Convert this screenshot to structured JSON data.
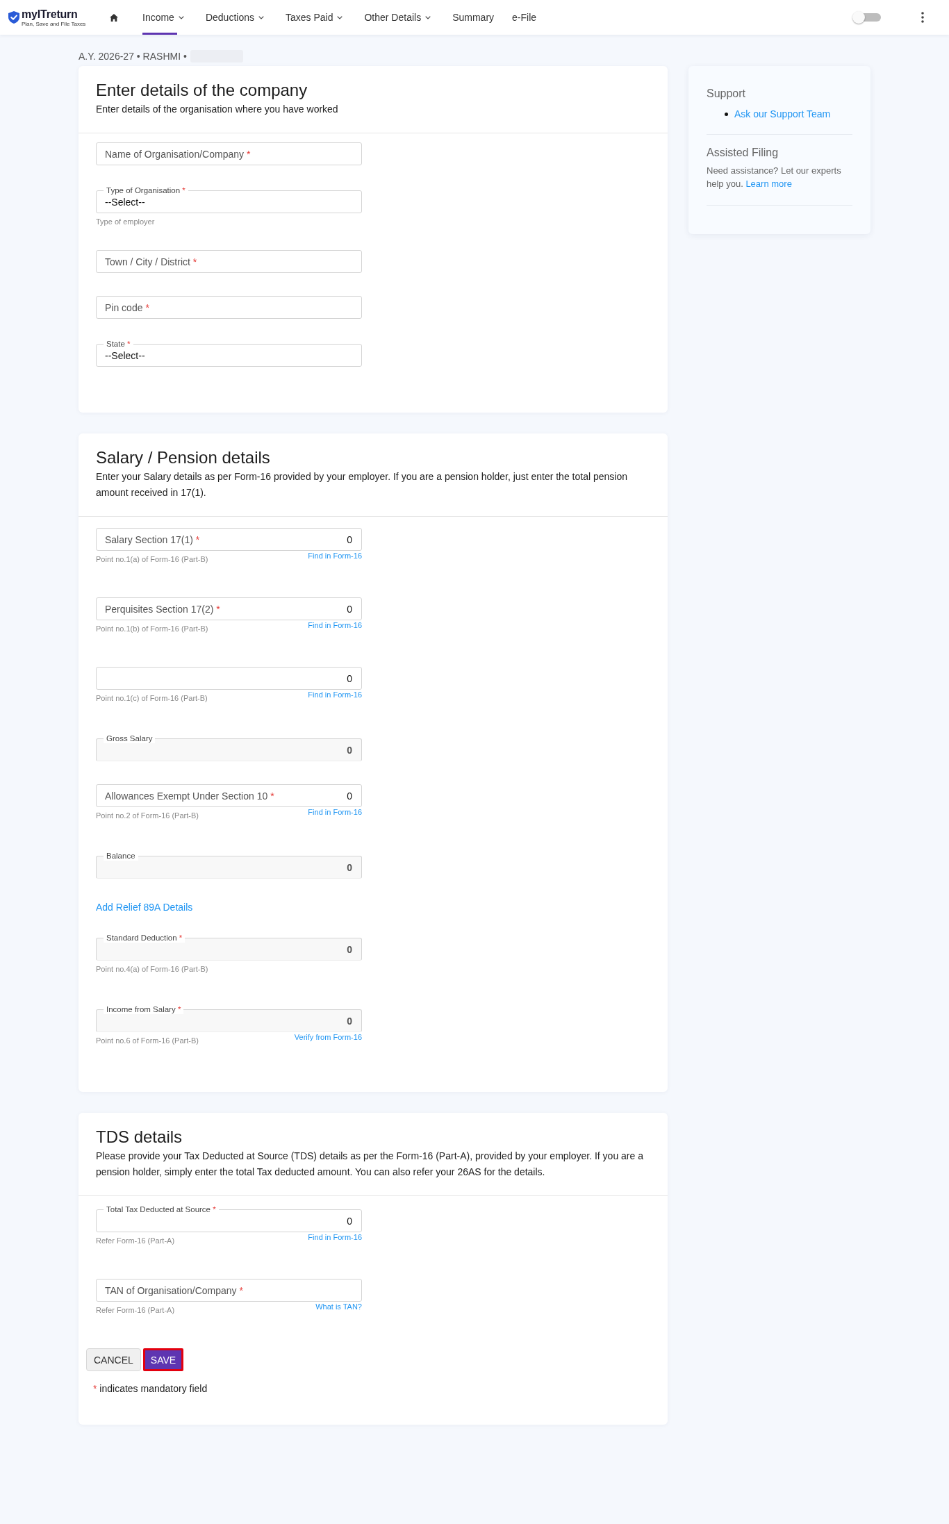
{
  "header": {
    "logo": {
      "wordmark": "myITreturn",
      "tagline": "Plan, Save and File Taxes"
    },
    "nav": [
      {
        "label": "Income",
        "menu": true,
        "selected": true
      },
      {
        "label": "Deductions",
        "menu": true,
        "selected": false
      },
      {
        "label": "Taxes Paid",
        "menu": true,
        "selected": false
      },
      {
        "label": "Other Details",
        "menu": true,
        "selected": false
      },
      {
        "label": "Summary",
        "menu": false,
        "selected": false
      },
      {
        "label": "e-File",
        "menu": false,
        "selected": false
      }
    ],
    "theme_toggle": {
      "on": false
    }
  },
  "breadcrumb": {
    "text": "A.Y. 2026-27 • RASHMI •",
    "redacted": true
  },
  "sections": [
    {
      "title": "Enter details of the company",
      "description": "Enter details of the organisation where you have worked",
      "fields": [
        {
          "kind": "inline",
          "label": "Name of Organisation/Company",
          "mark": "*",
          "disabled": false
        },
        {
          "kind": "select",
          "label": "Type of Organisation",
          "mark": "*",
          "value": "--Select--",
          "helper": "Type of employer",
          "disabled": false
        },
        {
          "kind": "inline",
          "label": "Town / City / District",
          "mark": "*",
          "disabled": false
        },
        {
          "kind": "inline",
          "label": "Pin code",
          "mark": "*",
          "disabled": false
        },
        {
          "kind": "select",
          "label": "State",
          "mark": "*",
          "value": "--Select--",
          "disabled": false
        }
      ]
    },
    {
      "title": "Salary / Pension details",
      "description": "Enter your Salary details as per Form-16 provided by your employer. If you are a pension holder, just enter the total pension amount received in 17(1).",
      "fields": [
        {
          "kind": "inline",
          "label": "Salary Section 17(1)",
          "mark": "*",
          "value": "0",
          "helper": "Point no.1(a) of Form-16 (Part-B)",
          "link": "Find in Form-16",
          "disabled": false
        },
        {
          "kind": "inline",
          "label": "Perquisites Section 17(2)",
          "mark": "*",
          "value": "0",
          "helper": "Point no.1(b) of Form-16 (Part-B)",
          "link": "Find in Form-16",
          "disabled": false
        },
        {
          "kind": "inline",
          "value": "0",
          "helper": "Point no.1(c) of Form-16 (Part-B)",
          "link": "Find in Form-16",
          "disabled": false
        },
        {
          "kind": "floating",
          "label": "Gross Salary",
          "value": "0",
          "disabled": true
        },
        {
          "kind": "inline",
          "label": "Allowances Exempt Under Section 10",
          "mark": "*",
          "value": "0",
          "helper": "Point no.2 of Form-16 (Part-B)",
          "link": "Find in Form-16",
          "disabled": false
        },
        {
          "kind": "floating",
          "label": "Balance",
          "value": "0",
          "disabled": true
        },
        {
          "kind": "link",
          "label": "Add Relief 89A Details"
        },
        {
          "kind": "floating",
          "label": "Standard Deduction",
          "mark": "*",
          "value": "0",
          "helper": "Point no.4(a) of Form-16 (Part-B)",
          "disabled": true
        },
        {
          "kind": "floating",
          "label": "Income from Salary",
          "mark": "*",
          "value": "0",
          "helper": "Point no.6 of Form-16 (Part-B)",
          "link": "Verify from Form-16",
          "disabled": true
        }
      ]
    },
    {
      "title": "TDS details",
      "description": "Please provide your Tax Deducted at Source (TDS) details as per the Form-16 (Part-A), provided by your employer. If you are a pension holder, simply enter the total Tax deducted amount. You can also refer your 26AS for the details.",
      "fields": [
        {
          "kind": "floating",
          "label": "Total Tax Deducted at Source",
          "mark": "*",
          "value": "0",
          "helper": "Refer Form-16 (Part-A)",
          "link": "Find in Form-16",
          "disabled": false
        },
        {
          "kind": "inline",
          "label": "TAN of Organisation/Company",
          "mark": "*",
          "helper": "Refer Form-16 (Part-A)",
          "link": "What is TAN?",
          "disabled": false
        }
      ],
      "actions": [
        {
          "kind": "cancel",
          "label": "CANCEL",
          "focused": false
        },
        {
          "kind": "save",
          "label": "SAVE",
          "focused": true
        }
      ],
      "note": {
        "mark": "*",
        "text": "indicates mandatory field"
      }
    }
  ],
  "sidebar": {
    "support": {
      "title": "Support",
      "links": [
        "Ask our Support Team"
      ]
    },
    "assisted_filing": {
      "title": "Assisted Filing",
      "text": "Need assistance? Let our experts help you.",
      "link": "Learn more"
    }
  }
}
